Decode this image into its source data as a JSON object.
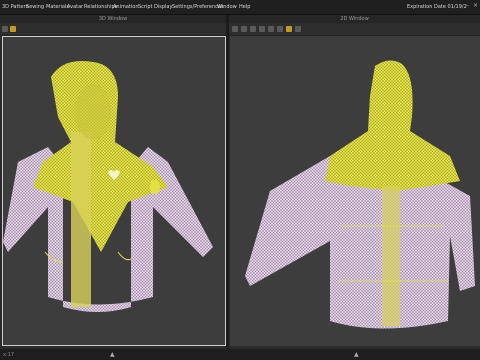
{
  "menubar": {
    "items": [
      "3D Pattern",
      "Sewing",
      "Materials",
      "Avatar",
      "Relationships",
      "Animation",
      "Script",
      "Display",
      "Settings/Preferences",
      "Window",
      "Help"
    ],
    "expiration": "Expiration Date 01/19/2"
  },
  "left_window": {
    "title": "3D Window"
  },
  "right_window": {
    "title": "2D Window"
  },
  "status": {
    "text": "x:17"
  },
  "colors": {
    "wire_yellow": "#e2e043",
    "wire_pink": "#e2cfe6",
    "viewport_bg": "#3d3d3d",
    "accent": "#d49a22"
  },
  "icons": {
    "left_tools": [
      "gear-icon",
      "cube-icon"
    ],
    "right_tools": [
      "camera-icon",
      "avatar-icon",
      "grid-icon",
      "color-icon"
    ]
  }
}
